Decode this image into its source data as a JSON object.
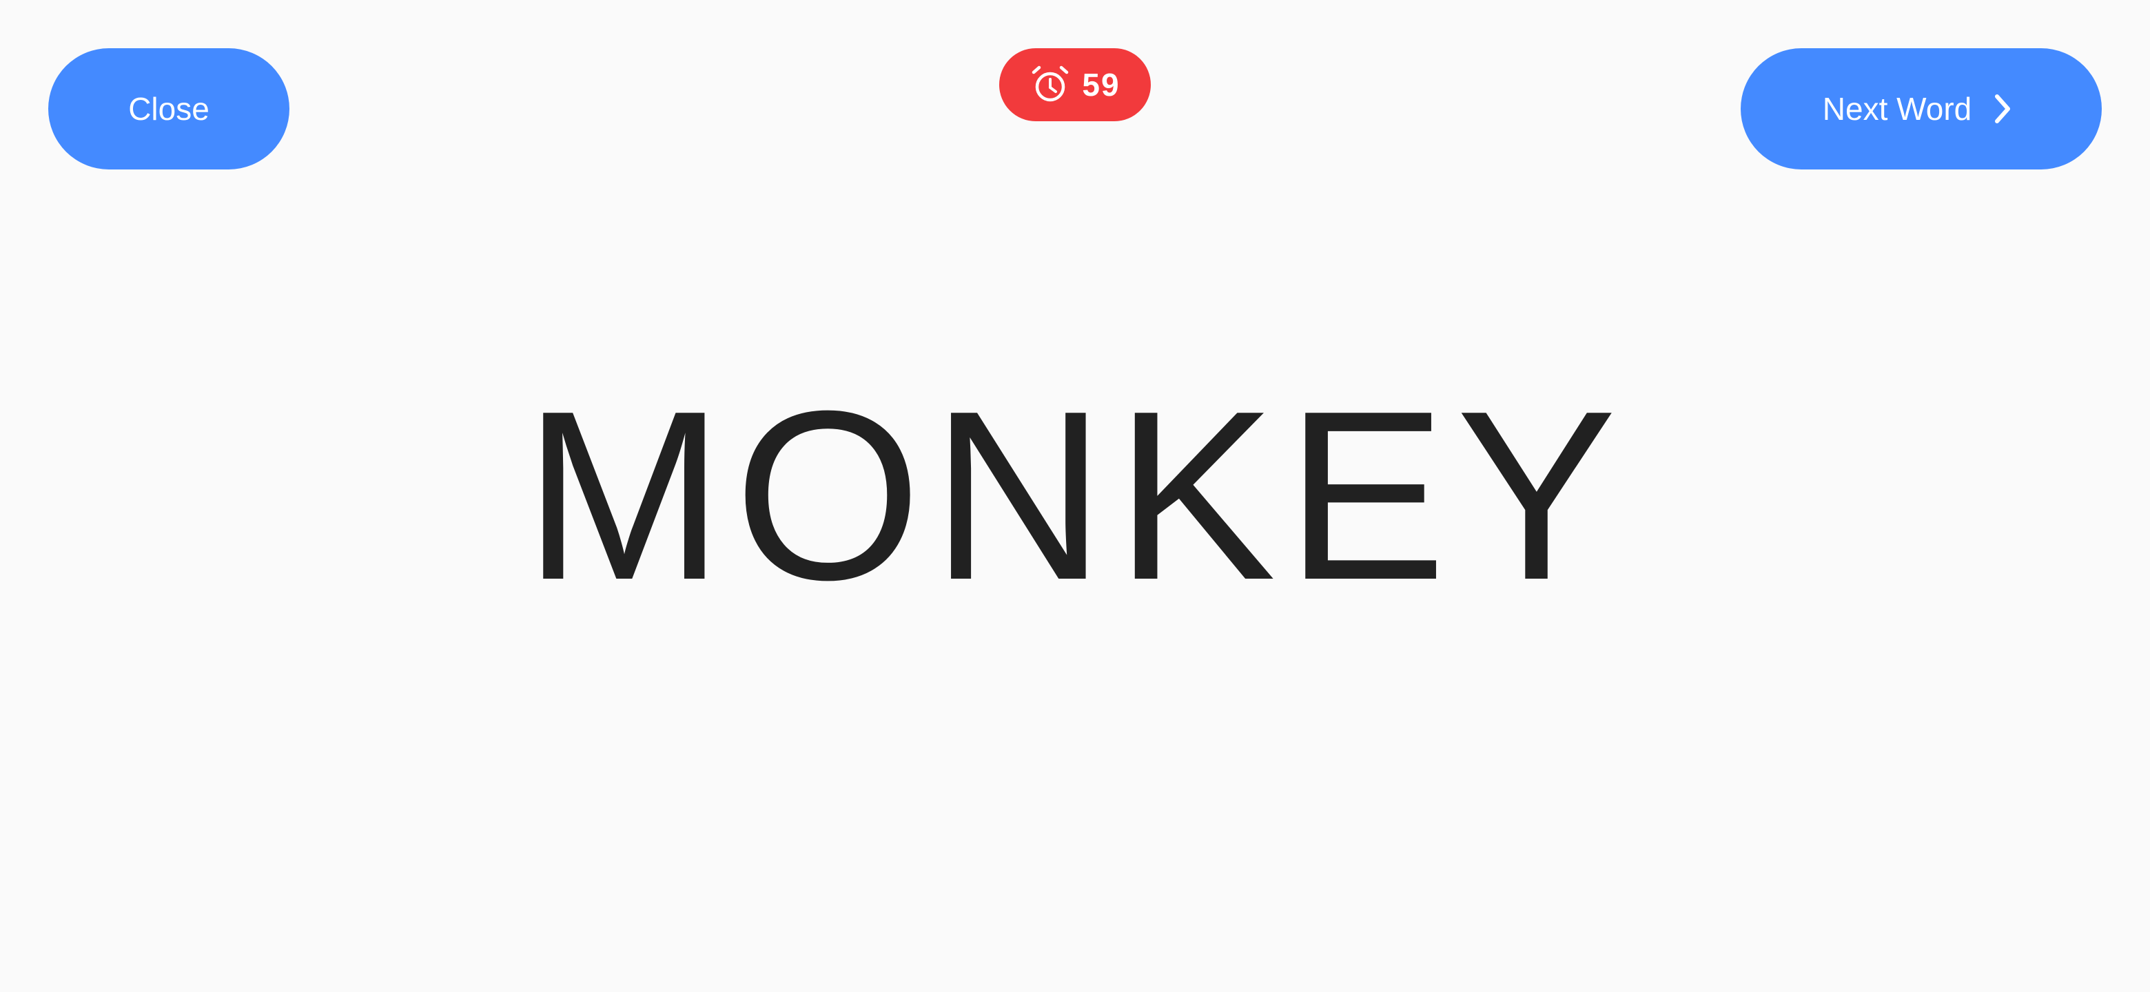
{
  "header": {
    "close_label": "Close",
    "next_label": "Next Word",
    "timer": {
      "value": "59",
      "icon": "alarm-clock-icon",
      "color": "#f23a3c"
    }
  },
  "main": {
    "word": "MONKEY"
  },
  "colors": {
    "accent": "#448aff",
    "background": "#fafafa",
    "text": "#212121"
  }
}
